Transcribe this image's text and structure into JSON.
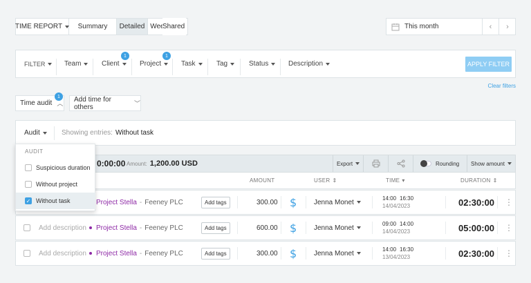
{
  "report_tabs": {
    "time_report": "TIME REPORT",
    "summary": "Summary",
    "detailed": "Detailed",
    "weekly": "Weekly",
    "shared": "Shared"
  },
  "date_range": {
    "label": "This month",
    "prev": "‹",
    "next": "›"
  },
  "filter_bar": {
    "filter": "FILTER",
    "team": "Team",
    "client": "Client",
    "client_count": "1",
    "project": "Project",
    "project_count": "1",
    "task": "Task",
    "tag": "Tag",
    "status": "Status",
    "description": "Description",
    "apply": "APPLY FILTER"
  },
  "clear_filters": "Clear filters",
  "time_audit": {
    "label": "Time audit",
    "count": "1",
    "add_time_for_others": "Add time for others"
  },
  "audit_bar": {
    "audit_label": "Audit",
    "showing_prefix": "Showing entries:",
    "showing_value": "Without task"
  },
  "audit_dropdown": {
    "header": "AUDIT",
    "items": [
      {
        "label": "Suspicious duration",
        "checked": false
      },
      {
        "label": "Without project",
        "checked": false
      },
      {
        "label": "Without task",
        "checked": true
      }
    ]
  },
  "summary_bar": {
    "total": "0:00:00",
    "amount_label": "Amount:",
    "amount_value": "1,200.00 USD",
    "export": "Export",
    "rounding": "Rounding",
    "show_amount": "Show amount"
  },
  "table_headers": {
    "amount": "AMOUNT",
    "user": "USER",
    "time": "TIME",
    "duration": "DURATION"
  },
  "entries": [
    {
      "description": "",
      "project": "Project Stella",
      "client": "Feeney PLC",
      "tag_btn": "Add tags",
      "amount": "300.00",
      "user": "Jenna Monet",
      "start": "14:00",
      "end": "16:30",
      "date": "14/04/2023",
      "duration": "02:30:00"
    },
    {
      "description": "Add description",
      "project": "Project Stella",
      "client": "Feeney PLC",
      "tag_btn": "Add tags",
      "amount": "600.00",
      "user": "Jenna Monet",
      "start": "09:00",
      "end": "14:00",
      "date": "14/04/2023",
      "duration": "05:00:00"
    },
    {
      "description": "Add description",
      "project": "Project Stella",
      "client": "Feeney PLC",
      "tag_btn": "Add tags",
      "amount": "300.00",
      "user": "Jenna Monet",
      "start": "14:00",
      "end": "16:30",
      "date": "13/04/2023",
      "duration": "02:30:00"
    }
  ],
  "colors": {
    "accent": "#3ea1e3",
    "apply_button": "#8fcdf4",
    "project": "#8e2aa6",
    "selected_tab": "#e4eaed"
  }
}
